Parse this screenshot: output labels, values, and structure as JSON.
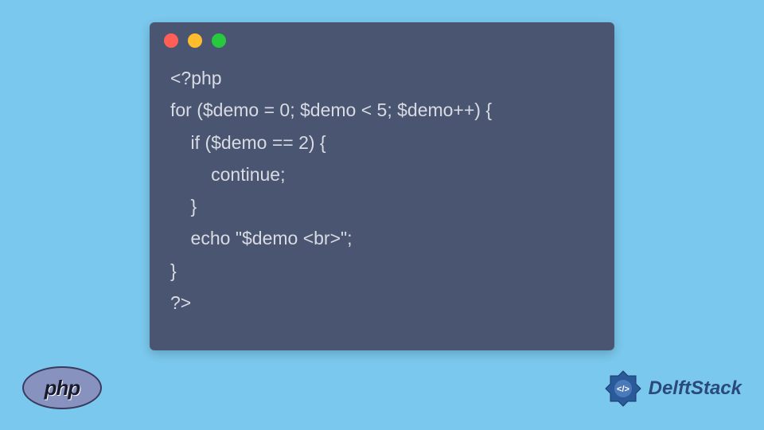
{
  "code": {
    "lines": [
      "<?php",
      "for ($demo = 0; $demo < 5; $demo++) {",
      "    if ($demo == 2) {",
      "        continue;",
      "    }",
      "    echo \"$demo <br>\";",
      "}",
      "?>"
    ]
  },
  "phpLogo": {
    "text": "php"
  },
  "delftLogo": {
    "text": "DelftStack"
  }
}
